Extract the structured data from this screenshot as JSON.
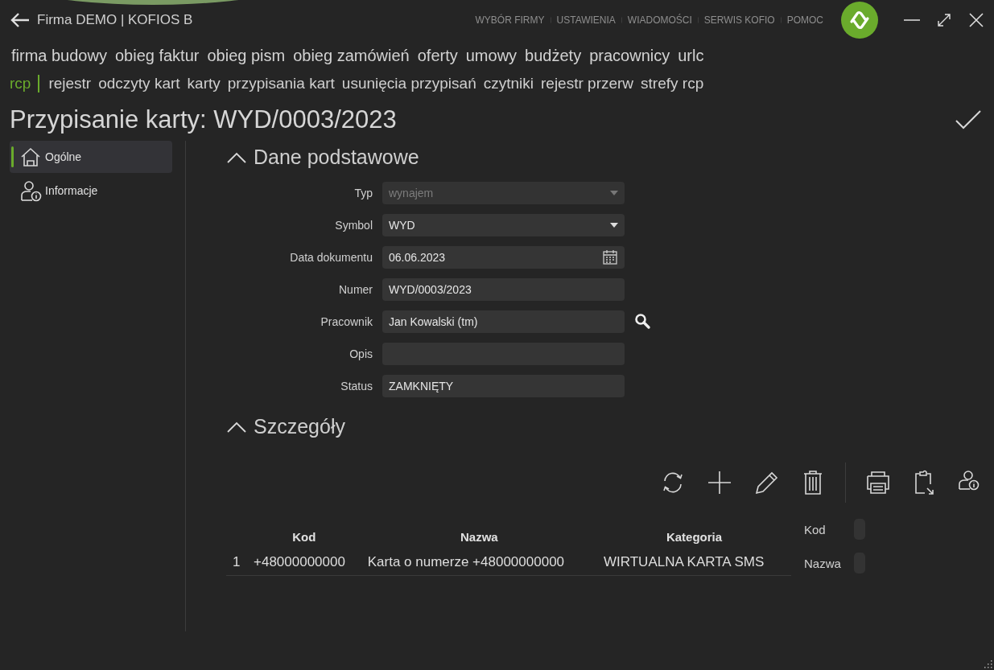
{
  "window": {
    "title": "Firma DEMO | KOFIOS B"
  },
  "top_links": [
    "WYBÓR FIRMY",
    "USTAWIENIA",
    "WIADOMOŚCI",
    "SERWIS KOFIO",
    "POMOC"
  ],
  "modules": [
    "firma budowy",
    "obieg faktur",
    "obieg pism",
    "obieg zamówień",
    "oferty",
    "umowy",
    "budżety",
    "pracownicy",
    "urlc"
  ],
  "submenu": {
    "section": "rcp",
    "items": [
      "rejestr",
      "odczyty kart",
      "karty",
      "przypisania kart",
      "usunięcia przypisań",
      "czytniki",
      "rejestr przerw",
      "strefy rcp"
    ]
  },
  "page_title": "Przypisanie karty: WYD/0003/2023",
  "sidebar": {
    "items": [
      {
        "label": "Ogólne",
        "selected": true
      },
      {
        "label": "Informacje",
        "selected": false
      }
    ]
  },
  "basic_section": {
    "title": "Dane podstawowe",
    "expanded": true,
    "fields": [
      {
        "label": "Typ",
        "kind": "dropdown",
        "value": "wynajem",
        "disabled": true
      },
      {
        "label": "Symbol",
        "kind": "dropdown",
        "value": "WYD",
        "disabled": false
      },
      {
        "label": "Data dokumentu",
        "kind": "date",
        "value": "06.06.2023",
        "disabled": false
      },
      {
        "label": "Numer",
        "kind": "text",
        "value": "WYD/0003/2023",
        "disabled": false
      },
      {
        "label": "Pracownik",
        "kind": "lookup",
        "value": "Jan Kowalski (tm)",
        "disabled": false
      },
      {
        "label": "Opis",
        "kind": "text",
        "disabled": false
      },
      {
        "label": "Status",
        "kind": "text",
        "value": "ZAMKNIĘTY",
        "disabled": false
      }
    ]
  },
  "details_section": {
    "title": "Szczegóły",
    "expanded": true,
    "table": {
      "columns": [
        "Kod",
        "Nazwa",
        "Kategoria"
      ],
      "rows": [
        {
          "number": "1",
          "cells": [
            "+48000000000",
            "Karta o numerze +48000000000",
            "WIRTUALNA KARTA SMS"
          ]
        }
      ]
    }
  },
  "filter_panel": {
    "fields": [
      {
        "label": "Kod"
      },
      {
        "label": "Nazwa"
      }
    ]
  }
}
